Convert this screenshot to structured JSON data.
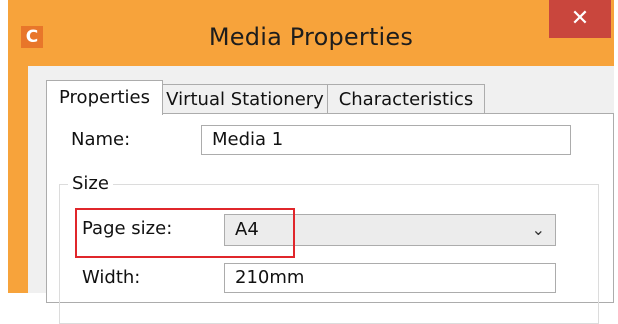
{
  "window": {
    "title": "Media Properties",
    "app_icon_letter": "C",
    "close_glyph": "✕",
    "accent_color": "#f7a33b",
    "close_color": "#c9463d"
  },
  "tabs": [
    {
      "label": "Properties",
      "active": true
    },
    {
      "label": "Virtual Stationery",
      "active": false
    },
    {
      "label": "Characteristics",
      "active": false
    }
  ],
  "form": {
    "name_label": "Name:",
    "name_value": "Media 1",
    "size_group_label": "Size",
    "page_size_label": "Page size:",
    "page_size_value": "A4",
    "width_label": "Width:",
    "width_value": "210mm"
  },
  "icons": {
    "dropdown": "chevron-down-icon",
    "app": "app-logo-icon",
    "close": "close-icon"
  },
  "highlight_color": "#e0262b"
}
